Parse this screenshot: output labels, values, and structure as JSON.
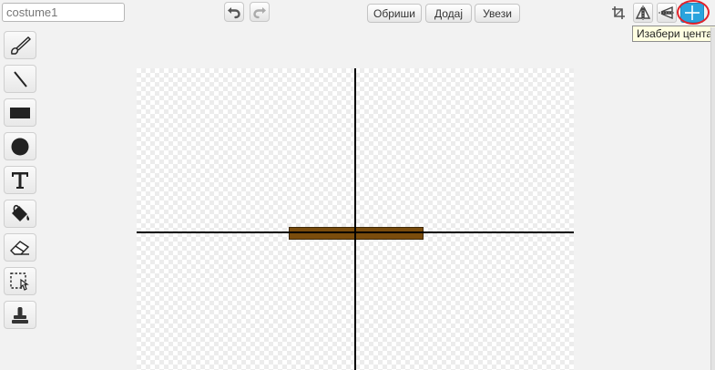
{
  "header": {
    "costume_name": "costume1",
    "buttons": {
      "clear": "Обриши",
      "add": "Додај",
      "import": "Увези"
    },
    "tooltip": "Изабери центар"
  },
  "colors": {
    "highlight_ring": "#e3222a",
    "active_tool": "#2aa3dd",
    "costume_fill": "#7a4c0c",
    "costume_stroke": "#3e2806"
  },
  "tools": [
    {
      "name": "brush",
      "icon": "brush-icon"
    },
    {
      "name": "line",
      "icon": "line-icon"
    },
    {
      "name": "rectangle",
      "icon": "rectangle-icon"
    },
    {
      "name": "ellipse",
      "icon": "ellipse-icon"
    },
    {
      "name": "text",
      "icon": "text-icon"
    },
    {
      "name": "fill",
      "icon": "paint-bucket-icon"
    },
    {
      "name": "eraser",
      "icon": "eraser-icon"
    },
    {
      "name": "select",
      "icon": "select-icon"
    },
    {
      "name": "stamp",
      "icon": "stamp-icon"
    }
  ],
  "top_icons": [
    "crop-icon",
    "flip-horizontal-icon",
    "flip-vertical-icon",
    "set-center-icon"
  ]
}
